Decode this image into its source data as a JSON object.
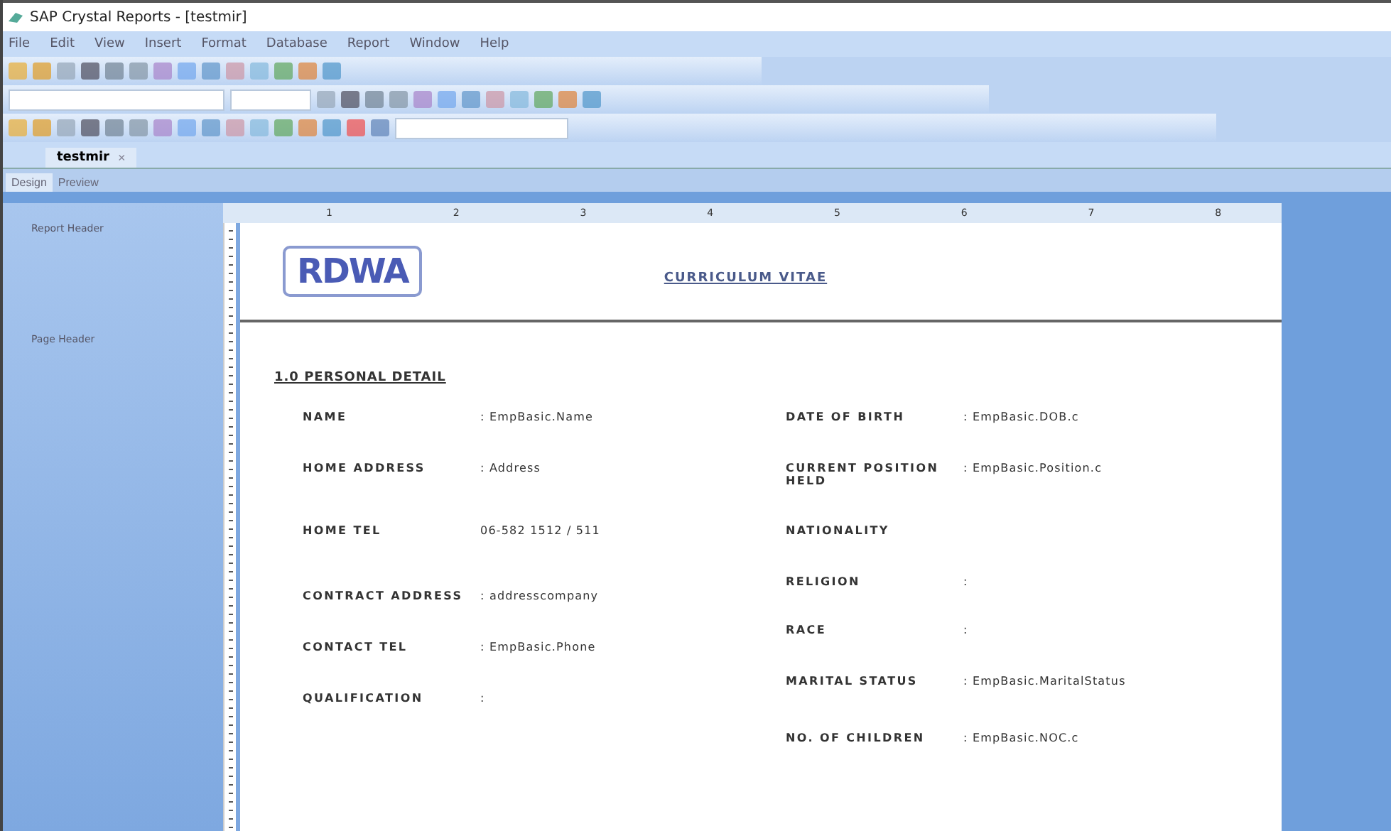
{
  "window": {
    "title": "SAP Crystal Reports - [testmir]"
  },
  "menu": [
    "File",
    "Edit",
    "View",
    "Insert",
    "Format",
    "Database",
    "Report",
    "Window",
    "Help"
  ],
  "document_tab": {
    "label": "testmir",
    "close": "×"
  },
  "view_tabs": [
    {
      "label": "Design",
      "selected": true
    },
    {
      "label": "Preview",
      "selected": false
    }
  ],
  "sections": [
    "Report Header",
    "Page Header"
  ],
  "ruler": [
    "1",
    "2",
    "3",
    "4",
    "5",
    "6",
    "7",
    "8"
  ],
  "report": {
    "logo": "RDWA",
    "title": "CURRICULUM VITAE",
    "heading": "1.0 PERSONAL DETAIL",
    "left_fields": [
      {
        "label": "NAME",
        "value": ": EmpBasic.Name"
      },
      {
        "label": "HOME ADDRESS",
        "value": ": Address"
      },
      {
        "label": "HOME TEL",
        "value": "06-582 1512 / 511"
      },
      {
        "label": "CONTRACT ADDRESS",
        "value": ": addresscompany"
      },
      {
        "label": "CONTACT TEL",
        "value": ": EmpBasic.Phone"
      },
      {
        "label": "QUALIFICATION",
        "value": ":"
      }
    ],
    "right_fields": [
      {
        "label": "DATE OF BIRTH",
        "value": ": EmpBasic.DOB.c"
      },
      {
        "label": "CURRENT POSITION HELD",
        "value": ": EmpBasic.Position.c"
      },
      {
        "label": "NATIONALITY"
      },
      {
        "label": "RELIGION",
        "value": ":"
      },
      {
        "label": "RACE",
        "value": ":"
      },
      {
        "label": "MARITAL STATUS",
        "value": ": EmpBasic.MaritalStatus"
      },
      {
        "label": "NO. OF CHILDREN",
        "value": ": EmpBasic.NOC.c"
      }
    ]
  }
}
